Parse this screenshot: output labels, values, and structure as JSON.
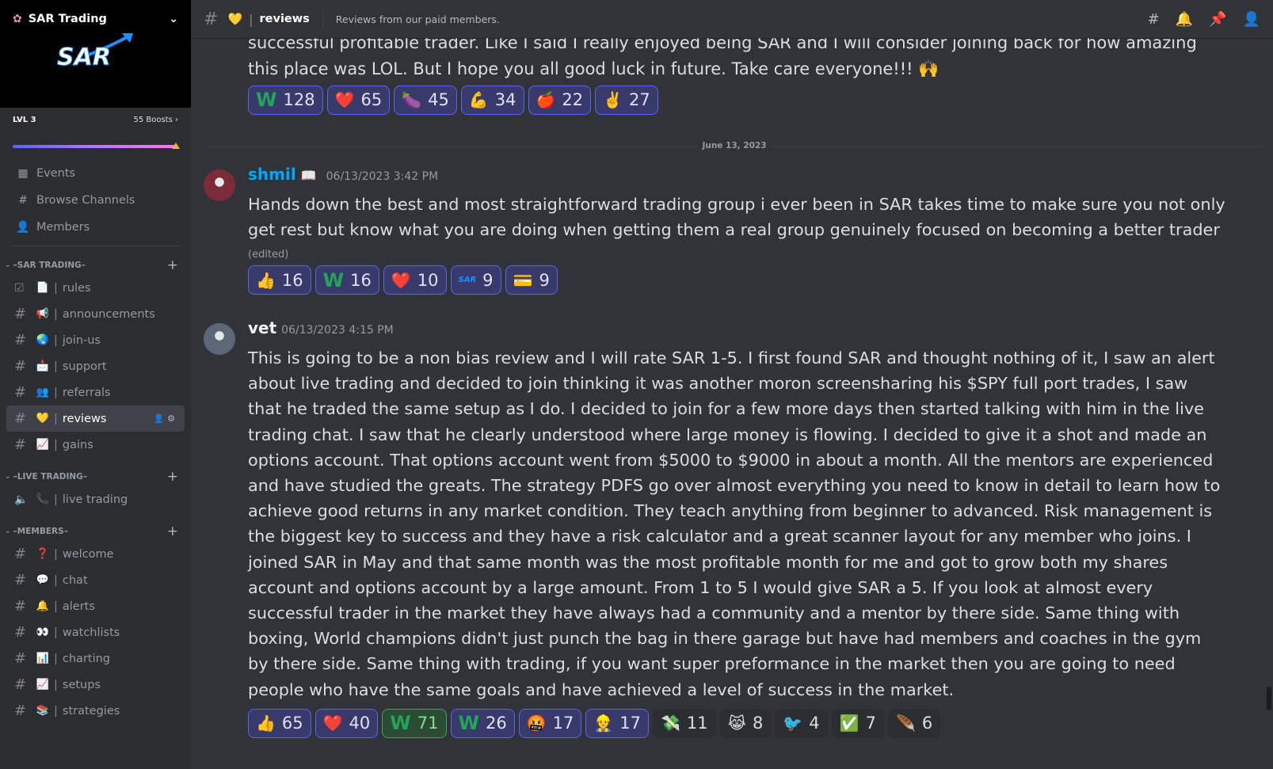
{
  "server": {
    "name": "SAR Trading",
    "logo_text": "SAR",
    "level": "LVL 3",
    "boosts": "55 Boosts"
  },
  "nav": [
    {
      "label": "Events",
      "icon": "calendar-icon"
    },
    {
      "label": "Browse Channels",
      "icon": "browse-channels-icon"
    },
    {
      "label": "Members",
      "icon": "members-icon"
    }
  ],
  "categories": [
    {
      "name": "–SAR TRADING–",
      "channels": [
        {
          "name": "rules",
          "emoji": "📄",
          "type": "rules"
        },
        {
          "name": "announcements",
          "emoji": "📢",
          "type": "text"
        },
        {
          "name": "join-us",
          "emoji": "🌏",
          "type": "text"
        },
        {
          "name": "support",
          "emoji": "📩",
          "type": "text"
        },
        {
          "name": "referrals",
          "emoji": "👥",
          "type": "text"
        },
        {
          "name": "reviews",
          "emoji": "💛",
          "type": "text",
          "active": true
        },
        {
          "name": "gains",
          "emoji": "📈",
          "type": "text"
        }
      ]
    },
    {
      "name": "–LIVE TRADING–",
      "channels": [
        {
          "name": "live trading",
          "emoji": "📞",
          "type": "voice"
        }
      ]
    },
    {
      "name": "–MEMBERS–",
      "channels": [
        {
          "name": "welcome",
          "emoji": "❓",
          "type": "text"
        },
        {
          "name": "chat",
          "emoji": "💬",
          "type": "text"
        },
        {
          "name": "alerts",
          "emoji": "🔔",
          "type": "text"
        },
        {
          "name": "watchlists",
          "emoji": "👀",
          "type": "text"
        },
        {
          "name": "charting",
          "emoji": "📊",
          "type": "text"
        },
        {
          "name": "setups",
          "emoji": "📈",
          "type": "text"
        },
        {
          "name": "strategies",
          "emoji": "📚",
          "type": "text"
        }
      ]
    }
  ],
  "header": {
    "channel": "reviews",
    "emoji": "💛",
    "topic": "Reviews from our paid members."
  },
  "continuation": {
    "text": "successful profitable trader. Like I said I really enjoyed being SAR and I will consider joining back for how amazing this place was LOL. But I hope you all good luck in future. Take care everyone!!! 🙌",
    "reactions": [
      {
        "emoji": "W",
        "count": "128",
        "me": true,
        "green": true
      },
      {
        "emoji": "❤️",
        "count": "65",
        "me": true
      },
      {
        "emoji": "🍆",
        "count": "45",
        "me": true
      },
      {
        "emoji": "💪",
        "count": "34",
        "me": true
      },
      {
        "emoji": "🍎",
        "count": "22",
        "me": true
      },
      {
        "emoji": "✌️",
        "count": "27",
        "me": true
      }
    ]
  },
  "date_divider": "June 13, 2023",
  "messages": [
    {
      "author": "shmil",
      "author_color": "#00a8fc",
      "badge": "📖",
      "timestamp": "06/13/2023 3:42 PM",
      "avatar_color": "#7b2b3a",
      "body": "Hands down the best and most straightforward trading group i ever been in SAR takes time to make sure you not only get rest but know what you are doing when getting them a real group genuinely focused on becoming a better trader",
      "edited": "(edited)",
      "reactions": [
        {
          "emoji": "👍",
          "count": "16",
          "me": true
        },
        {
          "emoji": "W",
          "count": "16",
          "me": true,
          "green": true
        },
        {
          "emoji": "❤️",
          "count": "10",
          "me": true
        },
        {
          "emoji": "SAR",
          "count": "9",
          "me": true,
          "logo": true
        },
        {
          "emoji": "💳",
          "count": "9",
          "me": true
        }
      ]
    },
    {
      "author": "vet",
      "author_color": "#f2f3f5",
      "badge": "",
      "timestamp": "06/13/2023 4:15 PM",
      "avatar_color": "#5c6878",
      "body": "This is going to be a non bias review and I will rate SAR 1-5. I first found SAR and thought nothing of it, I saw an alert about live trading and decided to join thinking it was another moron screensharing his $SPY full port trades, I saw that he traded the same setup as I do. I decided to join for a few more days then started talking with him in the live trading chat. I saw that he clearly understood where large money is flowing. I decided to give it a shot and made an options account. That options account went from $5000 to $9000 in about a month. All the mentors are experienced and have studied the greats. The strategy PDFS go over almost everything you need to know in detail to learn how to achieve good returns in any market condition. They teach anything from beginner to advanced. Risk management is the biggest key to success and they have a risk calculator and a great scanner layout for any member who joins. I joined SAR in May and that same month was the most profitable month for me and got to grow both my shares account and options account by a large amount. From 1 to 5 I would give SAR a 5. If you look at almost every successful trader in the market they have always had a community and a mentor by there side. Same thing with boxing, World champions didn't just punch the bag in there garage but have had members and coaches in the gym by there side. Same thing with trading, if you want super preformance in the market then you are going to need people who have the same goals and have achieved a level of success in the market.",
      "edited": "",
      "reactions": [
        {
          "emoji": "👍",
          "count": "65",
          "me": true
        },
        {
          "emoji": "❤️",
          "count": "40",
          "me": true
        },
        {
          "emoji": "W",
          "count": "71",
          "hi": true,
          "green": true
        },
        {
          "emoji": "W",
          "count": "26",
          "me": true,
          "green": true
        },
        {
          "emoji": "🤬",
          "count": "17",
          "me": true
        },
        {
          "emoji": "👷",
          "count": "17",
          "me": true
        },
        {
          "emoji": "💸",
          "count": "11"
        },
        {
          "emoji": "😹",
          "count": "8"
        },
        {
          "emoji": "🐦",
          "count": "4"
        },
        {
          "emoji": "✅",
          "count": "7"
        },
        {
          "emoji": "🪶",
          "count": "6"
        }
      ]
    }
  ],
  "colors": {
    "bg": "#313338",
    "sidebar": "#2b2d31",
    "accent": "#5865f2",
    "green": "#23a55a"
  }
}
